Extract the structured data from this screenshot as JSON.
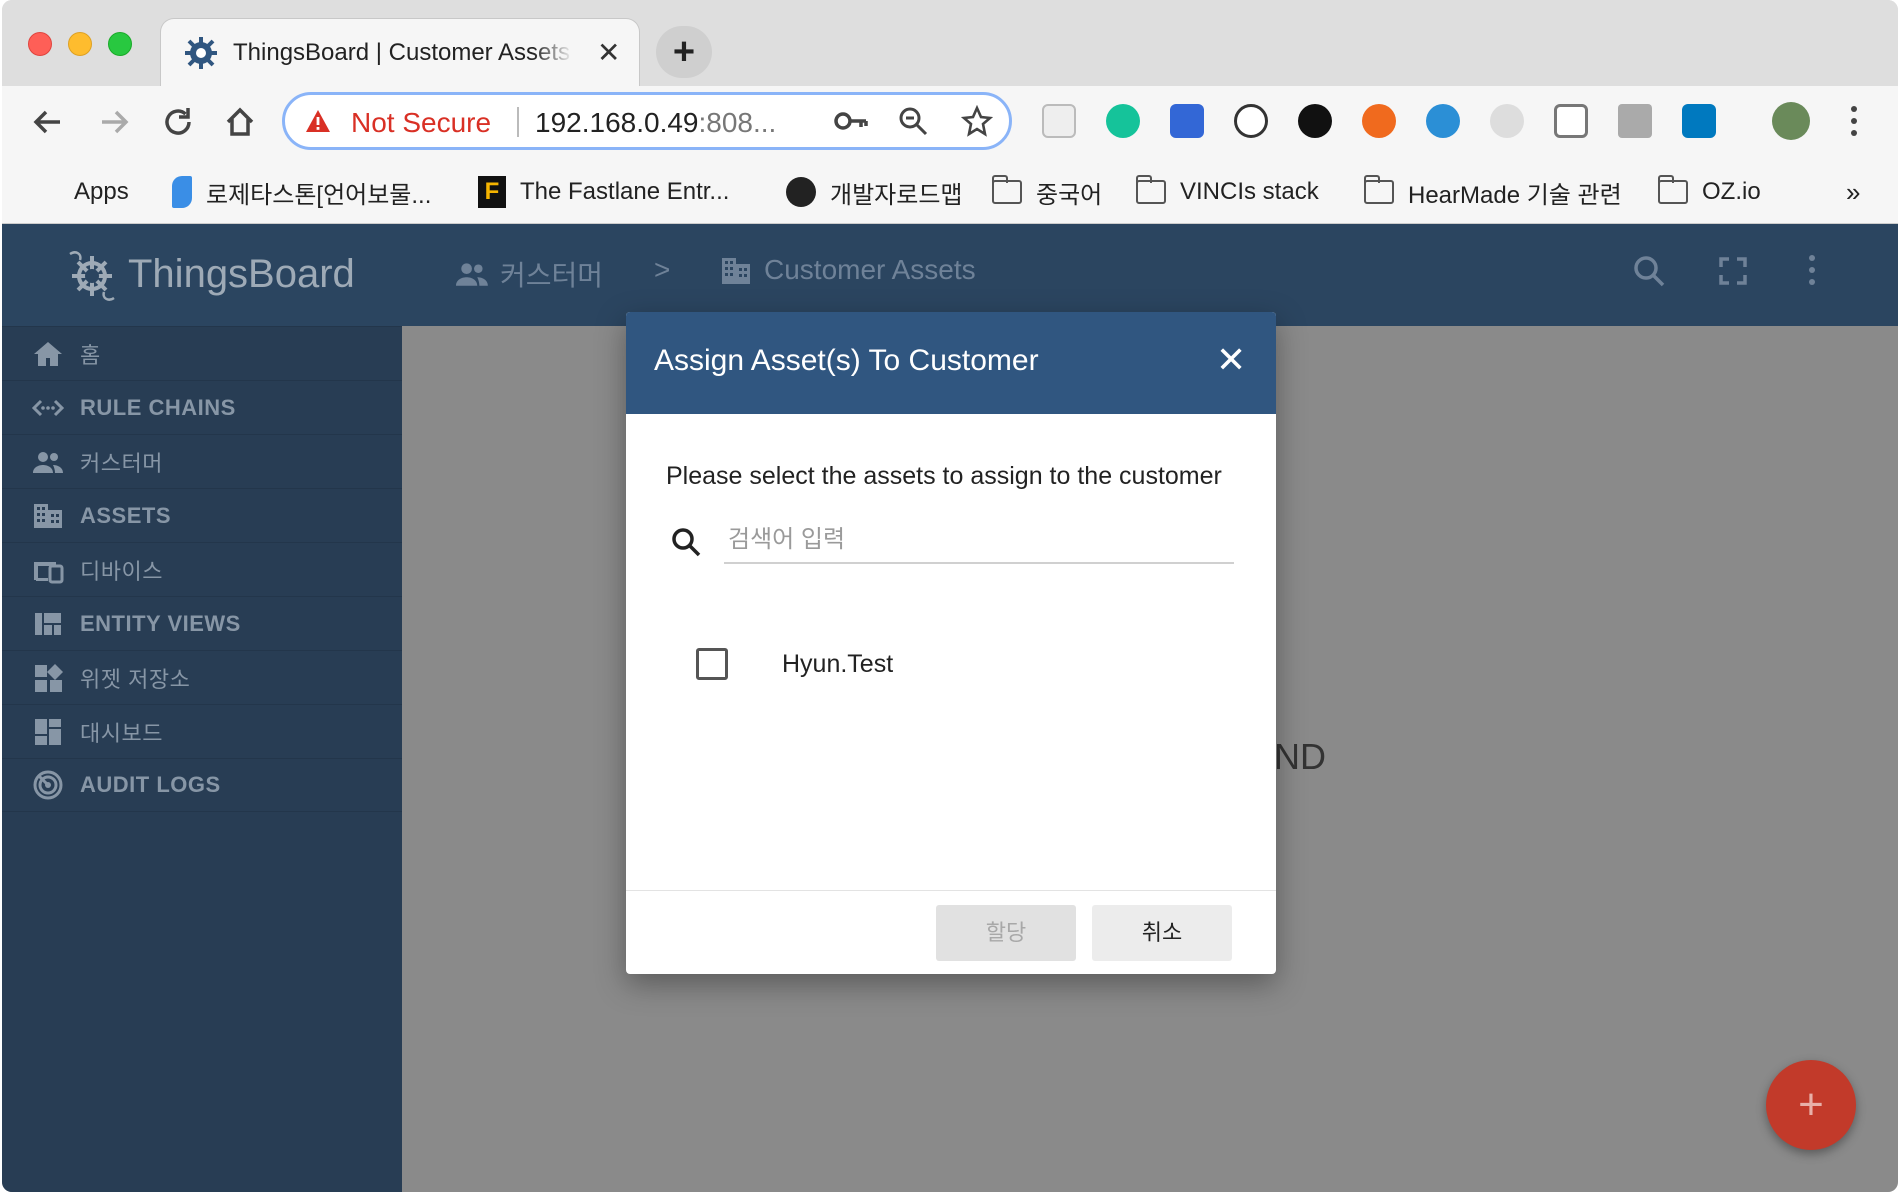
{
  "browser": {
    "tab_title": "ThingsBoard | Customer Assets",
    "tab_close": "✕",
    "new_tab": "+",
    "address": {
      "security_label": "Not Secure",
      "url_main": "192.168.0.49",
      "url_rest": ":808..."
    },
    "bookmarks": [
      {
        "label": "Apps"
      },
      {
        "label": "로제타스톤[언어보물..."
      },
      {
        "label": "The Fastlane Entr..."
      },
      {
        "label": "개발자로드맵"
      },
      {
        "label": "중국어"
      },
      {
        "label": "VINCIs stack"
      },
      {
        "label": "HearMade 기술 관련"
      },
      {
        "label": "OZ.io"
      }
    ],
    "bookmarks_overflow": "»"
  },
  "app": {
    "brand": "ThingsBoard",
    "sidebar": {
      "items": [
        {
          "label": "홈",
          "icon": "home-icon"
        },
        {
          "label": "RULE CHAINS",
          "icon": "rule-chains-icon"
        },
        {
          "label": "커스터머",
          "icon": "customers-icon"
        },
        {
          "label": "ASSETS",
          "icon": "assets-icon"
        },
        {
          "label": "디바이스",
          "icon": "devices-icon"
        },
        {
          "label": "ENTITY VIEWS",
          "icon": "entity-views-icon"
        },
        {
          "label": "위젯 저장소",
          "icon": "widgets-icon"
        },
        {
          "label": "대시보드",
          "icon": "dashboards-icon"
        },
        {
          "label": "AUDIT LOGS",
          "icon": "audit-logs-icon"
        }
      ]
    },
    "breadcrumb": {
      "parent": "커스터머",
      "separator": ">",
      "current": "Customer Assets"
    },
    "empty_state": "ND",
    "fab_label": "+"
  },
  "dialog": {
    "title": "Assign Asset(s) To Customer",
    "close": "✕",
    "prompt": "Please select the assets to assign to the customer",
    "search_placeholder": "검색어 입력",
    "items": [
      {
        "label": "Hyun.Test",
        "checked": false
      }
    ],
    "assign_label": "할당",
    "cancel_label": "취소"
  },
  "colors": {
    "sidebar_bg": "#283d54",
    "header_bg": "#2b4560",
    "dialog_header": "#305680",
    "fab": "#c23a2a",
    "warning": "#d93025"
  }
}
